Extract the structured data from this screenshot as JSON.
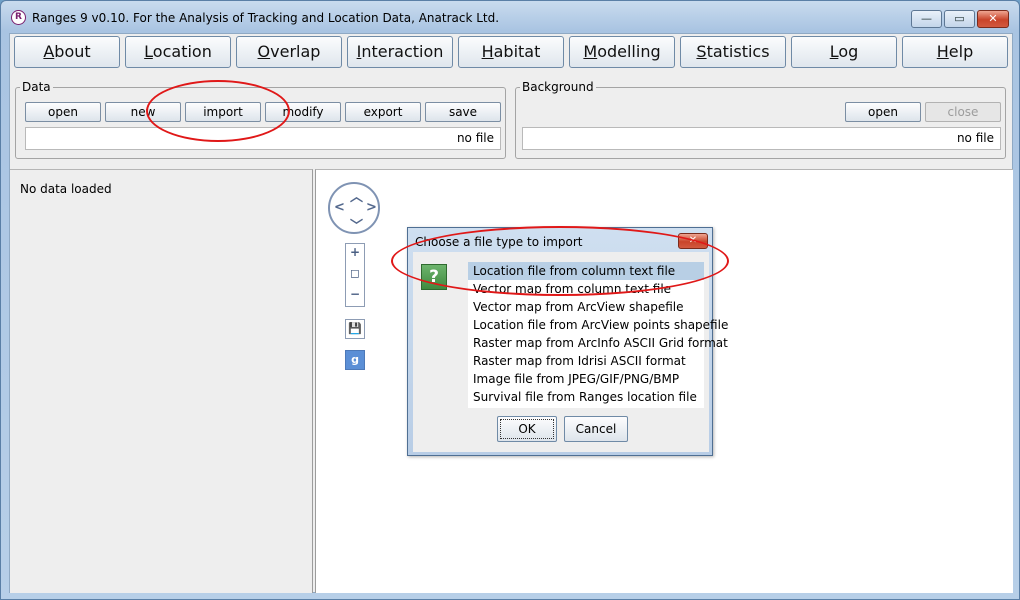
{
  "window": {
    "title": "Ranges 9 v0.10. For the Analysis of Tracking and Location Data, Anatrack Ltd.",
    "app_icon": "R",
    "controls": {
      "minimize": "—",
      "maximize": "▭",
      "close": "✕"
    }
  },
  "menu": [
    {
      "label": "About",
      "mnemonic": "A",
      "rest": "bout"
    },
    {
      "label": "Location",
      "mnemonic": "L",
      "rest": "ocation"
    },
    {
      "label": "Overlap",
      "mnemonic": "O",
      "rest": "verlap"
    },
    {
      "label": "Interaction",
      "mnemonic": "I",
      "rest": "nteraction"
    },
    {
      "label": "Habitat",
      "mnemonic": "H",
      "rest": "abitat"
    },
    {
      "label": "Modelling",
      "mnemonic": "M",
      "rest": "odelling"
    },
    {
      "label": "Statistics",
      "mnemonic": "S",
      "rest": "tatistics"
    },
    {
      "label": "Log",
      "mnemonic": "L",
      "rest": "og"
    },
    {
      "label": "Help",
      "mnemonic": "H",
      "rest": "elp"
    }
  ],
  "data_panel": {
    "legend": "Data",
    "buttons": [
      "open",
      "new",
      "import",
      "modify",
      "export",
      "save"
    ],
    "status": "no file"
  },
  "background_panel": {
    "legend": "Background",
    "open_label": "open",
    "close_label": "close",
    "status": "no file"
  },
  "left_pane": {
    "message": "No data loaded"
  },
  "map_controls": {
    "zoom_in": "+",
    "zoom_reset": "◻",
    "zoom_out": "−",
    "save_icon": "💾",
    "google_icon": "g"
  },
  "dialog": {
    "title": "Choose a file type to import",
    "close": "✕",
    "question_icon": "?",
    "options": [
      "Location file from column text file",
      "Vector map from column text file",
      "Vector map from ArcView shapefile",
      "Location file from ArcView points shapefile",
      "Raster map from ArcInfo ASCII Grid format",
      "Raster map from Idrisi ASCII format",
      "Image file from JPEG/GIF/PNG/BMP",
      "Survival file from Ranges location file"
    ],
    "selected_index": 0,
    "ok_label": "OK",
    "cancel_label": "Cancel"
  },
  "colors": {
    "annotation": "#e01818",
    "selection": "#b8cfe5",
    "frame": "#a9c4e2"
  }
}
